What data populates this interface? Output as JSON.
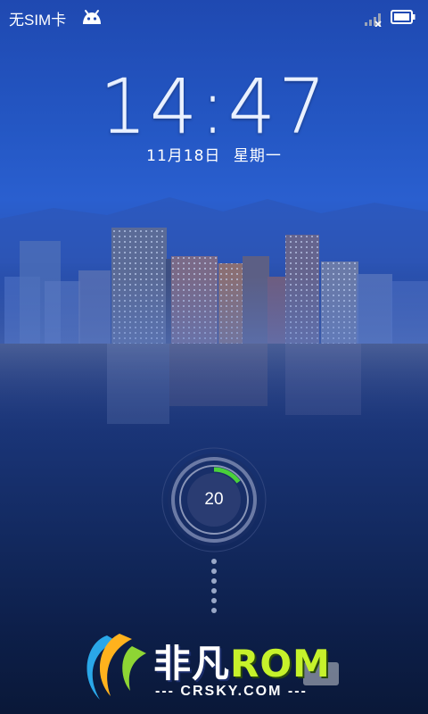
{
  "status_bar": {
    "carrier": "无SIM卡"
  },
  "lockscreen": {
    "time": "14:47",
    "date": "11月18日",
    "weekday": "星期一",
    "unlock_counter": "20",
    "unlock_progress_percent": 15
  },
  "watermark": {
    "name_part1": "非凡",
    "name_part2": "ROM",
    "site": "--- CRSKY.COM ---"
  }
}
